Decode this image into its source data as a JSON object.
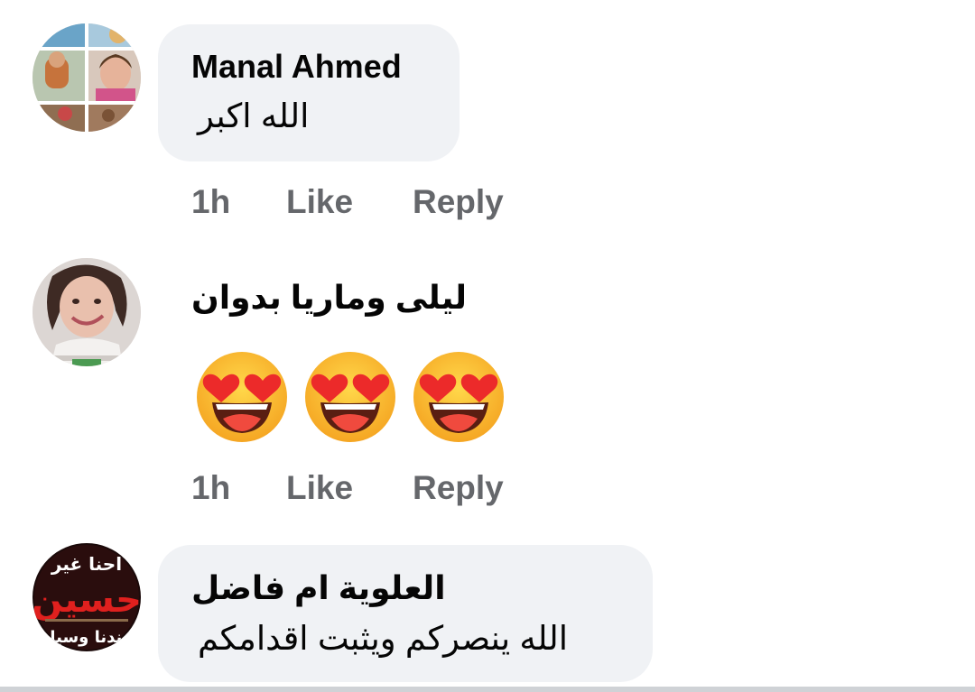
{
  "comments": [
    {
      "author": "Manal Ahmed",
      "text": "الله اكبر",
      "time": "1h",
      "like_label": "Like",
      "reply_label": "Reply"
    },
    {
      "author": "ليلى وماريا بدوان",
      "reaction": "smiling-face-with-heart-eyes ×3",
      "time": "1h",
      "like_label": "Like",
      "reply_label": "Reply"
    },
    {
      "author": "العلوية ام فاضل",
      "text": "الله ينصركم ويثبت اقدامكم",
      "avatar_text_line1": "احنا غير",
      "avatar_text_line2": "حسين",
      "avatar_text_line3": "عندنا وسيلة"
    }
  ],
  "colors": {
    "bubble": "#f0f2f5",
    "action_text": "#65676b",
    "name_text": "#050505"
  }
}
